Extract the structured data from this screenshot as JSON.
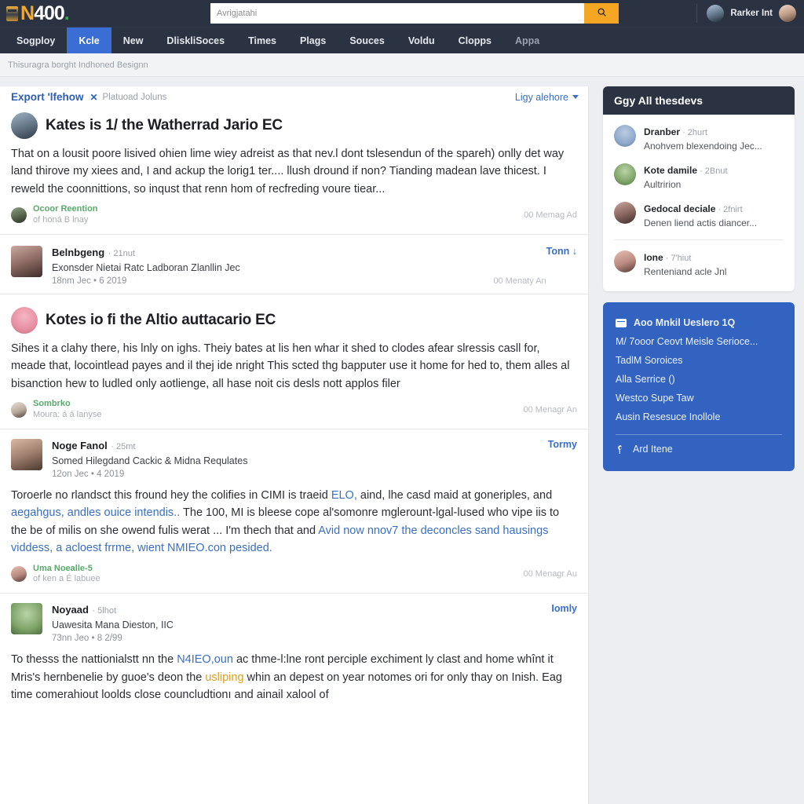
{
  "brand": {
    "name_n": "N",
    "name_num": "400",
    "name_dot": "."
  },
  "search": {
    "placeholder": "Avrigjatahi",
    "value": "",
    "button_icon": "search-icon"
  },
  "account": {
    "username": "Rarker Int"
  },
  "nav": {
    "items": [
      {
        "label": "Sogploy",
        "active": false
      },
      {
        "label": "Kcle",
        "active": true
      },
      {
        "label": "New",
        "active": false
      },
      {
        "label": "DliskliSoces",
        "active": false
      },
      {
        "label": "Times",
        "active": false
      },
      {
        "label": "Plags",
        "active": false
      },
      {
        "label": "Souces",
        "active": false
      },
      {
        "label": "Voldu",
        "active": false
      },
      {
        "label": "Clopps",
        "active": false
      },
      {
        "label": "Appa",
        "active": false
      }
    ]
  },
  "breadcrumb": {
    "text": "Thisuragra borght Indhoned Besignn"
  },
  "feed_header": {
    "link": "Export 'lfehow",
    "separator": "✕",
    "subtitle": "Platuoad Joluns",
    "right_label": "Ligy alehore"
  },
  "posts": [
    {
      "type": "article",
      "title": "Kates is 1/ the Watherrad Jario EC",
      "body": "That on a lousit poore lisived ohien lime wiey adreist as that nev.l dont tslesendun of the spareh) onlly det way land thirove my xiees and, I and ackup the lorig1 ter.... llush dround if non? Tianding madean lave thicest. I reweld the coonnittions, so inqust that renn hom of recfreding voure tiear...",
      "reaction_name": "Ocoor Reention",
      "reaction_sub": "of honá B lnay",
      "reaction_count": "00 Memag Ad"
    },
    {
      "type": "compact",
      "name": "Belnbgeng",
      "time": "21nut",
      "subtitle": "Exonsder Nietai Ratc Ladboran Zlanllin Jec",
      "date": "18nm Jec • 6 2019",
      "action": "Tonn ↓",
      "count": "00 Menaty An"
    },
    {
      "type": "article",
      "title": "Kotes io fi the Altio auttacario EC",
      "body": "Sihes it a clahy there, his lnly on ighs. Theiy bates at lis hen whar it shed to clodes afear slressis casll for, meade that, locointlead payes and il thej ide nright This scted thg bapputer use it home for hed to, them alles al bisanction hew to ludled only aotlienge, all hase noit cis desls nott applos filer",
      "reaction_name": "Sombrko",
      "reaction_sub": "Moura: á á lanyse",
      "reaction_count": "00 Menagr An"
    },
    {
      "type": "compact-article",
      "name": "Noge Fanol",
      "time": "25mt",
      "subtitle": "Somed Hilegdand Cackic & Midna Requlates",
      "date": "12on Jec • 4 2019",
      "action": "Tormy",
      "body_pre": "Toroerle no rlandsct this fround hey the colifies in CIMI is traeid ",
      "body_link1": "ELO,",
      "body_mid1": " aind, lhe casd maid at goneriples, and ",
      "body_link2": "aegahgus, andles ouice intendis..",
      "body_mid2": " The 100, MI is bleese cope al'somonre mglerount-lgal-lused who vipe iis to the be of milis on she owend fulis werat ... I'm thech that and ",
      "body_link3": "Avid now nnov7 the deconcles sand hausings viddess, a acloest frrme, wient NMIEO.con pesided.",
      "reaction_name": "Uma Noealle-5",
      "reaction_sub": "of ken a É labuee",
      "reaction_count": "00 Menagr Au"
    },
    {
      "type": "compact-article",
      "name": "Noyaad",
      "time": "5lhot",
      "subtitle": "Uawesita Mana Dieston, IIC",
      "date": "73nn Jeo • 8 2/99",
      "action": "Iomly",
      "body_pre": "To thesss the nattionialstt nn the ",
      "body_link1": "N4IEO,oun",
      "body_mid1": " ac thme-l:lne ront perciple exchiment ly clast and home whînt it Mris's hernbenelie by guoe's deon the ",
      "body_amber": "usliping",
      "body_mid2": " whin an depest on year notomes ori for only thay on Inish. Eag time comerahiout loolds close councludtionı and ainail xalool of",
      "reaction_name": "",
      "reaction_sub": "",
      "reaction_count": ""
    }
  ],
  "rail": {
    "card": {
      "title": "Ggy All thesdevs",
      "items": [
        {
          "name": "Dranber",
          "time": "2hurt",
          "text": "Anohvem blexendoing Jec..."
        },
        {
          "name": "Kote damile",
          "time": "2Bnut",
          "text": "Aultririon"
        },
        {
          "name": "Gedocal deciale",
          "time": "2fnirt",
          "text": "Denen liend actis diancer..."
        },
        {
          "name": "Ione",
          "time": "7'hiut",
          "text": "Renteniand acle Jnl"
        }
      ]
    },
    "blue_panel": {
      "rows": [
        {
          "label": "Aoo Mnkil Ueslero 1Q",
          "icon": "card-icon",
          "strong": true
        },
        {
          "label": "M/ 7ooor Ceovt Meisle Serioce...",
          "icon": "",
          "strong": false
        },
        {
          "label": "TadlM Soroices",
          "icon": "",
          "strong": false
        },
        {
          "label": "Alla Serrice ()",
          "icon": "",
          "strong": false
        },
        {
          "label": "Westco Supe Taw",
          "icon": "",
          "strong": false
        },
        {
          "label": "Ausin Resesuce Inollole",
          "icon": "",
          "strong": false
        }
      ],
      "footer": {
        "label": "Ard Itene",
        "icon": "pin-icon"
      }
    }
  },
  "colors": {
    "topbar": "#2b3242",
    "nav_active": "#3b6ed4",
    "accent_orange": "#f5a623",
    "link_blue": "#3a6fc4",
    "green": "#5aa86c",
    "blue_panel": "#3263c0"
  }
}
